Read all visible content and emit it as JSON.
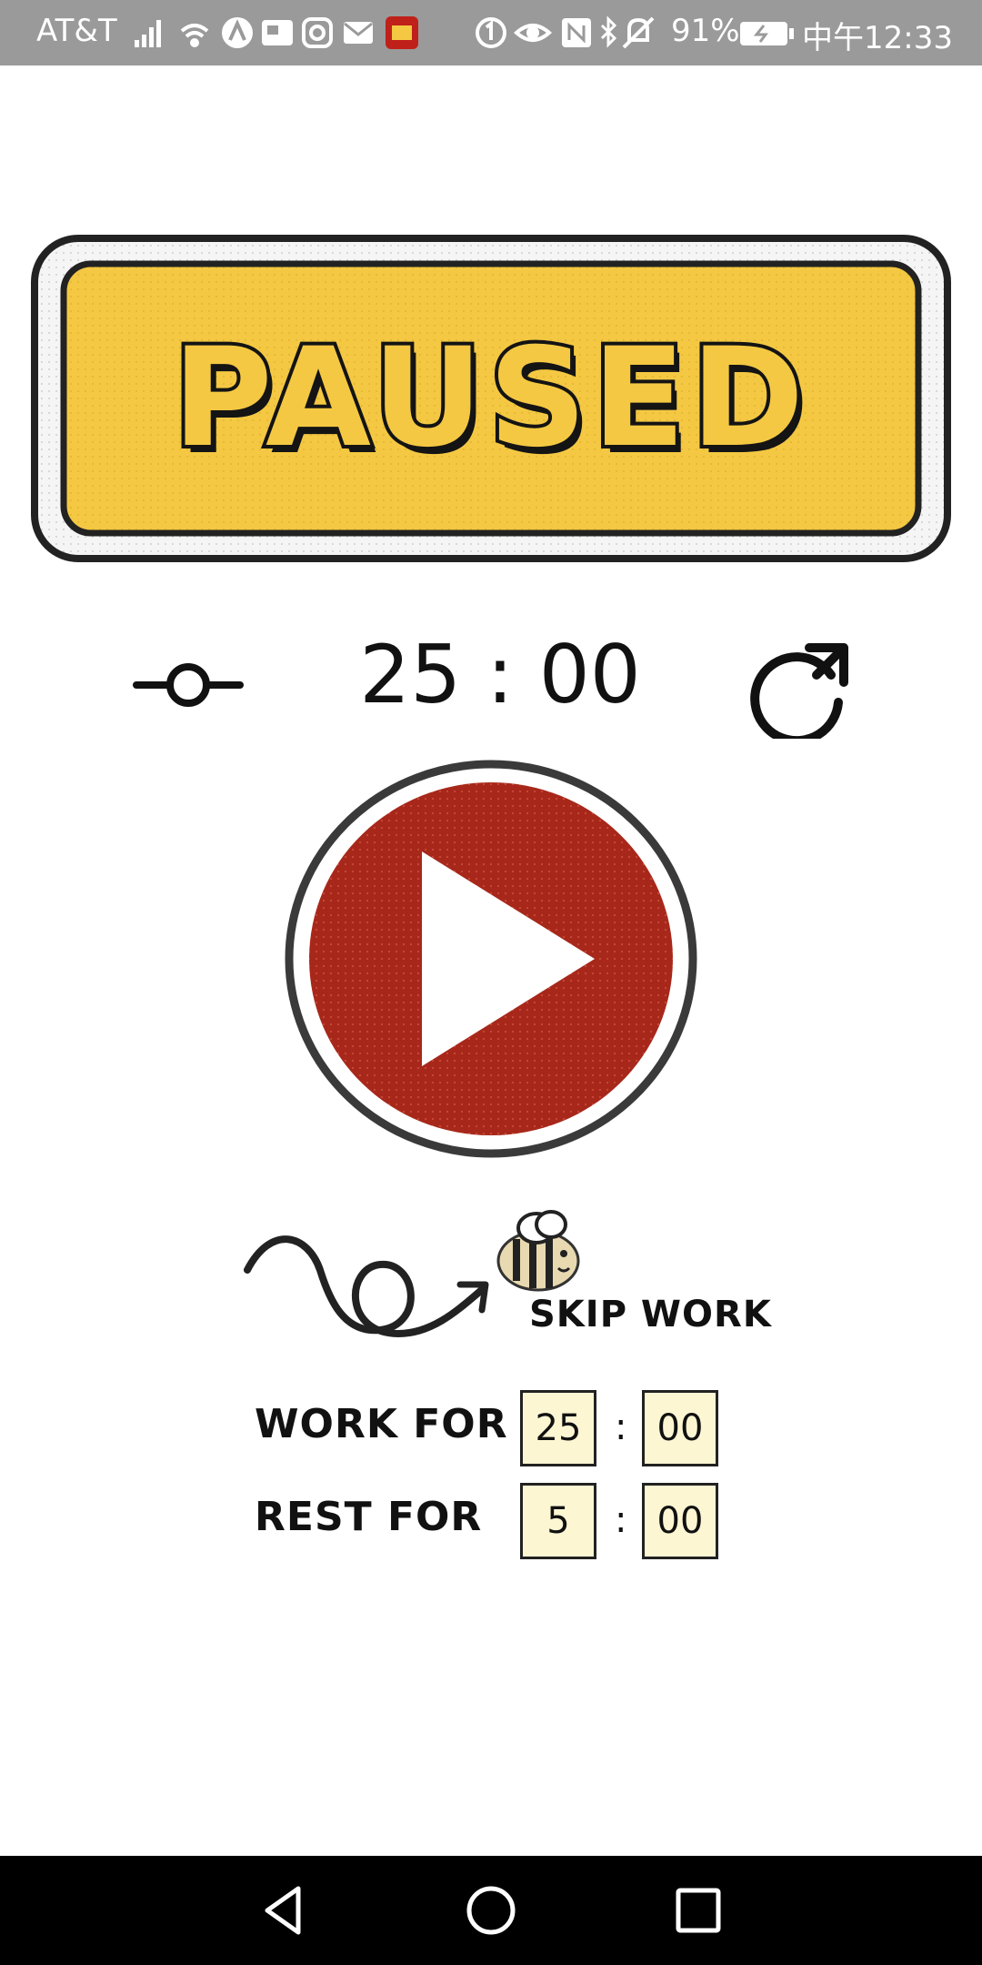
{
  "status_bar": {
    "carrier": "AT&T",
    "battery_percent": "91%",
    "time": "中午12:33",
    "icons": [
      "signal-icon",
      "wifi-icon",
      "app-notification-icon",
      "photo-notification-icon",
      "instagram-icon",
      "mail-icon",
      "app-icon",
      "data-saver-icon",
      "eye-icon",
      "nfc-icon",
      "bluetooth-icon",
      "mute-icon",
      "battery-icon"
    ]
  },
  "banner": {
    "title": "PAUSED",
    "fill_color": "#f4c842"
  },
  "controls": {
    "timer": "25 : 00",
    "settings_icon": "slider-icon",
    "reset_icon": "refresh-icon"
  },
  "play": {
    "icon": "play-icon",
    "color": "#a7281a"
  },
  "skip": {
    "label": "SKIP WORK",
    "icon": "bee-icon"
  },
  "settings": {
    "work": {
      "label": "WORK FOR",
      "minutes": "25",
      "seconds": "00"
    },
    "rest": {
      "label": "REST FOR",
      "minutes": "5",
      "seconds": "00"
    },
    "separator": ":"
  },
  "nav": {
    "icons": [
      "back-icon",
      "home-icon",
      "recents-icon"
    ]
  }
}
